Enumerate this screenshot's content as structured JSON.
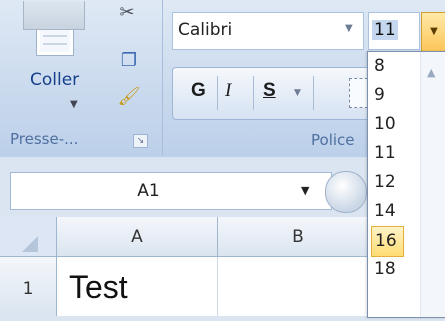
{
  "clipboard": {
    "paste_label": "Coller",
    "group_label": "Presse-...",
    "paste_arrow": "▼",
    "launcher": "↘",
    "icons": {
      "cut": "scissors-icon",
      "copy": "copy-icon",
      "format_painter": "paintbrush-icon"
    }
  },
  "font": {
    "name": "Calibri",
    "size": "11",
    "bold": "G",
    "italic": "I",
    "underline": "S",
    "group_label": "Police",
    "dropdown_arrow": "▼",
    "accent_color": "#fcc65a"
  },
  "size_list": {
    "items": [
      "8",
      "9",
      "10",
      "11",
      "12",
      "14",
      "16",
      "18"
    ],
    "selected": "16",
    "scroll_up": "▲"
  },
  "formula_bar": {
    "name_box": "A1",
    "name_arrow": "▼"
  },
  "grid": {
    "columns": [
      "A",
      "B"
    ],
    "rows": [
      "1"
    ],
    "cells": {
      "A1": "Test"
    }
  }
}
